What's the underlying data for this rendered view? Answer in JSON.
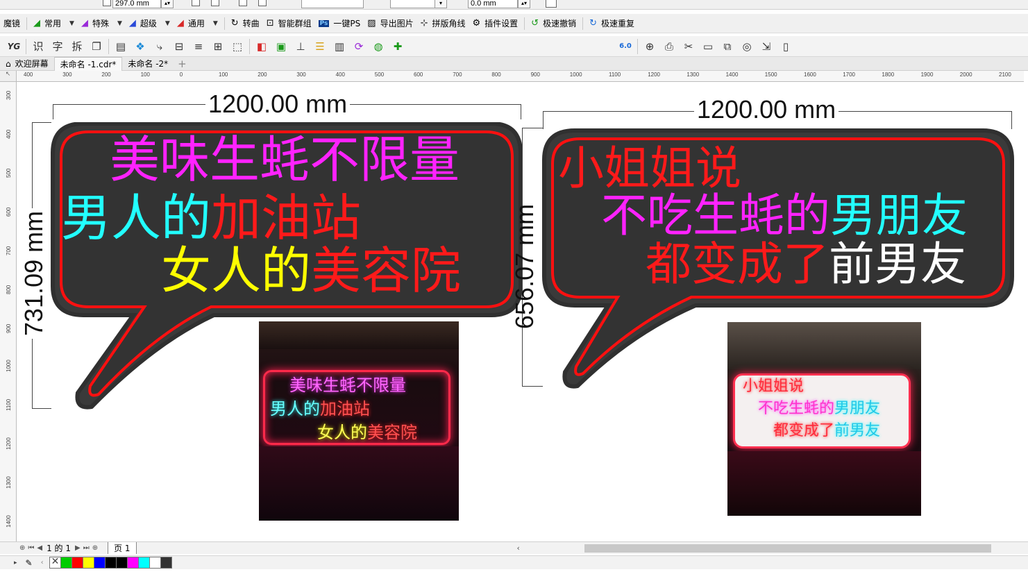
{
  "topbar": {
    "width_value": "297.0 mm",
    "nudge_value": "0.0 mm"
  },
  "pluginbar": {
    "title": "魔镜",
    "items": [
      {
        "label": "常用",
        "icon": "brush-icon"
      },
      {
        "label": "特殊",
        "icon": "brush-icon"
      },
      {
        "label": "超级",
        "icon": "brush-icon"
      },
      {
        "label": "通用",
        "icon": "brush-icon"
      },
      {
        "label": "转曲",
        "icon": "curve-icon"
      },
      {
        "label": "智能群组",
        "icon": "group-icon"
      },
      {
        "label": "一键PS",
        "icon": "ps-icon"
      },
      {
        "label": "导出图片",
        "icon": "image-icon"
      },
      {
        "label": "拼版角线",
        "icon": "cropmark-icon"
      },
      {
        "label": "插件设置",
        "icon": "gear-icon"
      },
      {
        "label": "极速撤销",
        "icon": "undo-icon"
      },
      {
        "label": "极速重复",
        "icon": "redo-icon"
      }
    ]
  },
  "toolbar2": {
    "items": [
      "YG",
      "识",
      "字",
      "拆",
      "",
      "",
      "",
      "",
      "",
      "",
      "",
      "",
      "",
      "",
      "",
      "",
      "",
      "",
      "",
      ""
    ],
    "version_badge": "6.0"
  },
  "tabs": [
    {
      "label": "欢迎屏幕"
    },
    {
      "label": "未命名 -1.cdr*"
    },
    {
      "label": "未命名 -2*"
    }
  ],
  "ruler": {
    "h_labels": [
      "400",
      "300",
      "200",
      "100",
      "0",
      "100",
      "200",
      "300",
      "400",
      "500",
      "600",
      "700",
      "800",
      "900",
      "1000",
      "1100",
      "1200",
      "1300",
      "1400",
      "1500",
      "1600",
      "1700",
      "1800",
      "1900",
      "2000",
      "2100"
    ],
    "v_labels": [
      "300",
      "400",
      "500",
      "600",
      "700",
      "800",
      "900",
      "1000",
      "1100",
      "1200",
      "1300",
      "1400"
    ]
  },
  "left_sign": {
    "width_dim": "1200.00 mm",
    "height_dim": "731.09 mm",
    "line1": "美味生蚝不限量",
    "line2_a": "男人的",
    "line2_b": "加油站",
    "line3_a": "女人的",
    "line3_b": "美容院",
    "colors": {
      "line1": "#ff22ff",
      "line2_a": "#22ffff",
      "line2_b": "#ff1a1a",
      "line3_a": "#ffff00",
      "line3_b": "#ff1a1a"
    }
  },
  "right_sign": {
    "width_dim": "1200.00 mm",
    "height_dim": "656.07 mm",
    "line1": "小姐姐说",
    "line2_a": "不吃生蚝的",
    "line2_b": "男朋友",
    "line3_a": "都变成了",
    "line3_b": "前男友",
    "colors": {
      "line1": "#ff1a1a",
      "line2_a": "#ff22ff",
      "line2_b": "#22ffff",
      "line3_a": "#ff1a1a",
      "line3_b": "#ffffff"
    }
  },
  "photo_left": {
    "line1": "美味生蚝不限量",
    "line2_a": "男人的",
    "line2_b": "加油站",
    "line3_a": "女人的",
    "line3_b": "美容院"
  },
  "photo_right": {
    "line1": "小姐姐说",
    "line2_a": "不吃生蚝的",
    "line2_b": "男朋友",
    "line3_a": "都变成了",
    "line3_b": "前男友"
  },
  "bottombar": {
    "page_counter": "1 的 1",
    "page_tab": "页 1"
  },
  "palette": {
    "colors": [
      "#00cc00",
      "#ff0000",
      "#ffff00",
      "#0000ff",
      "#000000",
      "#000000",
      "#ff00ff",
      "#00ffff",
      "#ffffff",
      "#333333"
    ]
  }
}
